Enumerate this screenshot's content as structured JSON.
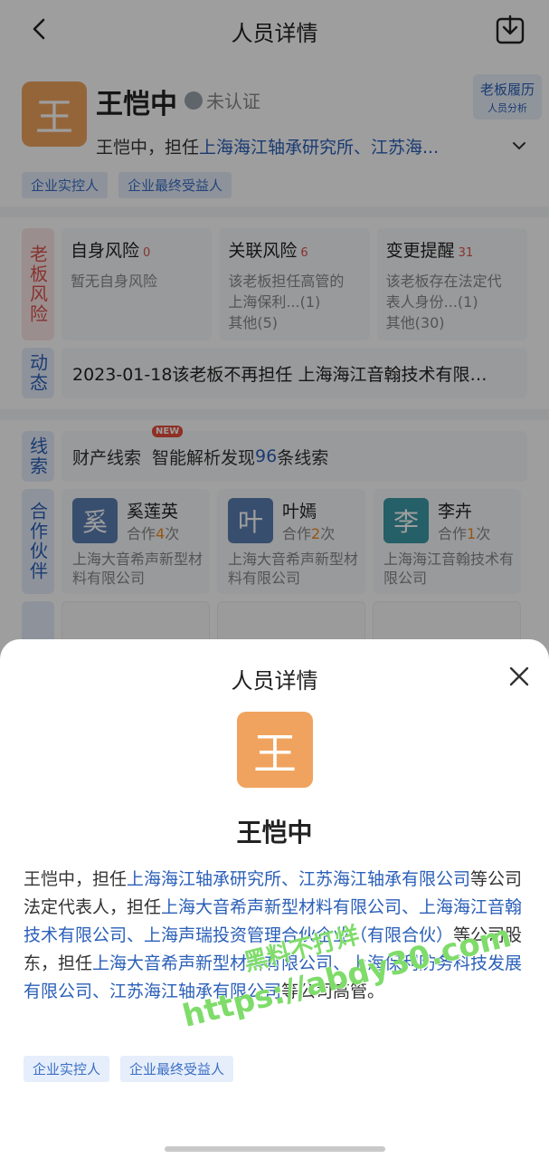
{
  "nav": {
    "title": "人员详情"
  },
  "profile": {
    "avatar_char": "王",
    "name": "王恺中",
    "verify_text": "未认证",
    "boss_card_line1": "老板履历",
    "boss_card_line2": "人员分析",
    "desc_prefix": "王恺中，担任",
    "desc_link": "上海海江轴承研究所、江苏海...",
    "tags": [
      "企业实控人",
      "企业最终受益人"
    ]
  },
  "risk": {
    "side_label": "老板风险",
    "cards": [
      {
        "title": "自身风险",
        "count": "0",
        "lines": [
          "暂无自身风险"
        ]
      },
      {
        "title": "关联风险",
        "count": "6",
        "lines": [
          "该老板担任高管的",
          "上海保利...(1)",
          "其他(5)"
        ]
      },
      {
        "title": "变更提醒",
        "count": "31",
        "lines": [
          "该老板存在法定代",
          "表人身份...(1)",
          "其他(30)"
        ]
      }
    ]
  },
  "dynamic": {
    "side_label": "动态",
    "text": "2023-01-18该老板不再担任 上海海江音翰技术有限…"
  },
  "clue": {
    "side_label": "线索",
    "prefix": "财产线索",
    "badge": "NEW",
    "text_a": "智能解析发现",
    "number": "96",
    "text_b": "条线索"
  },
  "partners": {
    "side_label": "合作伙伴",
    "items": [
      {
        "avatar": "奚",
        "name": "奚莲英",
        "coop_prefix": "合作",
        "count": "4",
        "coop_suffix": "次",
        "company": "上海大音希声新型材料有限公司",
        "color": "#5b7fb3"
      },
      {
        "avatar": "叶",
        "name": "叶嫣",
        "coop_prefix": "合作",
        "count": "2",
        "coop_suffix": "次",
        "company": "上海大音希声新型材料有限公司",
        "color": "#5b7fb3"
      },
      {
        "avatar": "李",
        "name": "李卉",
        "coop_prefix": "合作",
        "count": "1",
        "coop_suffix": "次",
        "company": "上海海江音翰技术有限公司",
        "color": "#3d9aa6"
      }
    ]
  },
  "sheet": {
    "title": "人员详情",
    "avatar_char": "王",
    "name": "王恺中",
    "desc_parts": [
      {
        "t": "王恺中，担任",
        "link": false
      },
      {
        "t": "上海海江轴承研究所、江苏海江轴承有限公司",
        "link": true
      },
      {
        "t": "等公司法定代表人，担任",
        "link": false
      },
      {
        "t": "上海大音希声新型材料有限公司、上海海江音翰技术有限公司、上海声瑞投资管理合伙企业（有限合伙）",
        "link": true
      },
      {
        "t": "等公司股东，担任",
        "link": false
      },
      {
        "t": "上海大音希声新型材料有限公司、上海保利防务科技发展有限公司、江苏海江轴承有限公司",
        "link": true
      },
      {
        "t": "等公司高管。",
        "link": false
      }
    ],
    "tags": [
      "企业实控人",
      "企业最终受益人"
    ]
  },
  "watermark": {
    "line1": "黑料不打烊",
    "line2": "https://abdy30.com"
  },
  "colors": {
    "brand_orange": "#f0a35e",
    "link_blue": "#2a5fb8",
    "risk_red": "#d9534f"
  }
}
